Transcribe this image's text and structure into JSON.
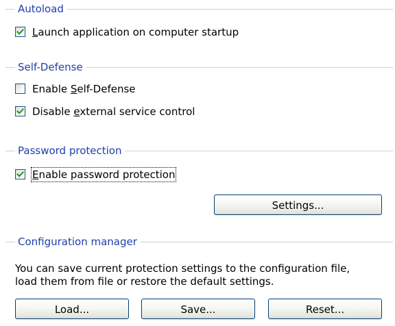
{
  "autoload": {
    "title": "Autoload",
    "launch_on_startup": {
      "label_accel": "L",
      "label_rest": "aunch application on computer startup",
      "checked": true
    }
  },
  "self_defense": {
    "title": "Self-Defense",
    "enable_self_defense": {
      "label_pre": "Enable ",
      "label_accel": "S",
      "label_rest": "elf-Defense",
      "checked": false
    },
    "disable_external_control": {
      "label_pre": "Disable ",
      "label_accel": "e",
      "label_rest": "xternal service control",
      "checked": true
    }
  },
  "password_protection": {
    "title": "Password protection",
    "enable_password": {
      "label_accel": "E",
      "label_rest": "nable password protection",
      "checked": true
    },
    "settings_button": "Settings..."
  },
  "configuration_manager": {
    "title": "Configuration manager",
    "description_line1": "You can save current protection settings to the configuration file,",
    "description_line2": "load them from file or restore the default settings.",
    "load_button": "Load...",
    "save_button": "Save...",
    "reset_button": "Reset..."
  },
  "colors": {
    "group_title": "#1e3fa8",
    "checkbox_border": "#1c5180",
    "checkmark": "#21a121",
    "button_border": "#003c74"
  }
}
